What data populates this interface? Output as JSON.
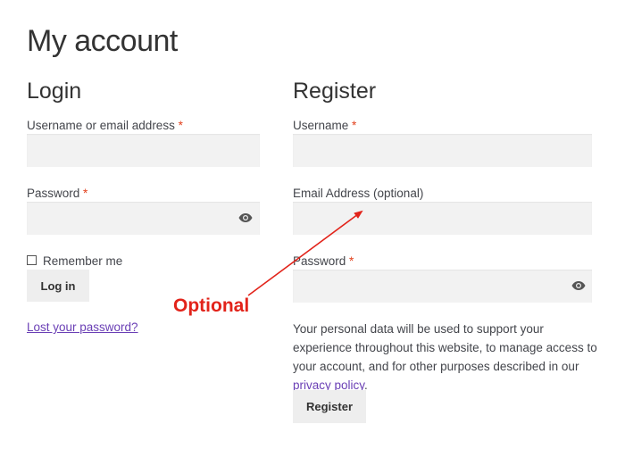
{
  "page": {
    "title": "My account"
  },
  "login": {
    "title": "Login",
    "username_label": "Username or email address",
    "username_required": "*",
    "password_label": "Password",
    "password_required": "*",
    "remember_label": "Remember me",
    "login_button": "Log in",
    "lost_password_link": "Lost your password?"
  },
  "register": {
    "title": "Register",
    "username_label": "Username",
    "username_required": "*",
    "email_label": "Email Address (optional)",
    "password_label": "Password",
    "password_required": "*",
    "privacy_before": "Your personal data will be used to support your experience throughout this website, to manage access to your account, and for other purposes described in our ",
    "privacy_link": "privacy policy",
    "privacy_after": ".",
    "register_button": "Register"
  },
  "annotation": {
    "label": "Optional",
    "color": "#e2231a"
  },
  "icons": {
    "password_toggle": "eye-icon"
  },
  "colors": {
    "required": "#e2401c",
    "link": "#6a3fb5",
    "field_bg": "#f2f2f2",
    "button_bg": "#eeeeee"
  }
}
